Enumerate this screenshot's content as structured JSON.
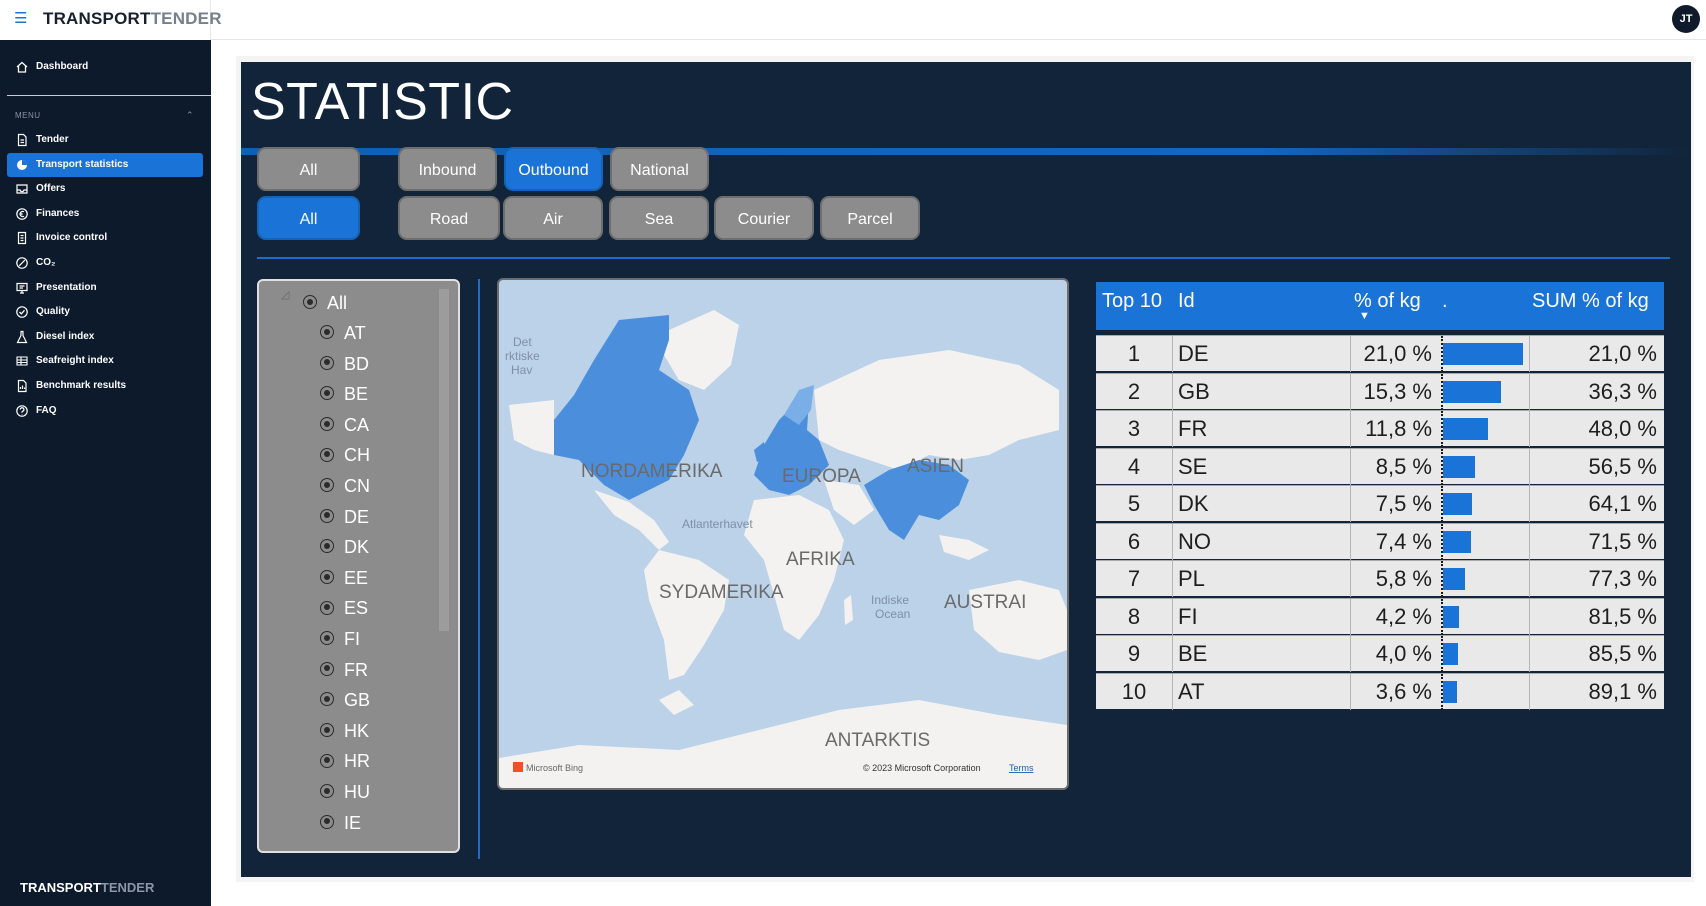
{
  "brand": {
    "part1": "TRANSPORT",
    "part2": "TENDER"
  },
  "user": {
    "initials": "JT"
  },
  "sidebar": {
    "top_item": {
      "label": "Dashboard",
      "icon": "home-icon"
    },
    "menu_label": "MENU",
    "items": [
      {
        "label": "Tender",
        "icon": "document-icon",
        "active": false
      },
      {
        "label": "Transport statistics",
        "icon": "pie-chart-icon",
        "active": true
      },
      {
        "label": "Offers",
        "icon": "inbox-icon",
        "active": false
      },
      {
        "label": "Finances",
        "icon": "euro-icon",
        "active": false
      },
      {
        "label": "Invoice control",
        "icon": "invoice-icon",
        "active": false
      },
      {
        "label": "CO₂",
        "icon": "co2-icon",
        "active": false
      },
      {
        "label": "Presentation",
        "icon": "presentation-icon",
        "active": false
      },
      {
        "label": "Quality",
        "icon": "check-circle-icon",
        "active": false
      },
      {
        "label": "Diesel index",
        "icon": "flask-icon",
        "active": false
      },
      {
        "label": "Seafreight index",
        "icon": "ship-icon",
        "active": false
      },
      {
        "label": "Benchmark results",
        "icon": "report-icon",
        "active": false
      },
      {
        "label": "FAQ",
        "icon": "help-icon",
        "active": false
      }
    ],
    "footer": {
      "part1": "TRANSPORT",
      "part2": "TENDER"
    }
  },
  "report": {
    "title": "STATISTIC",
    "direction_filters": [
      {
        "label": "All",
        "selected": false
      },
      {
        "label": "Inbound",
        "selected": false
      },
      {
        "label": "Outbound",
        "selected": true
      },
      {
        "label": "National",
        "selected": false
      }
    ],
    "mode_filters": [
      {
        "label": "All",
        "selected": true
      },
      {
        "label": "Road",
        "selected": false
      },
      {
        "label": "Air",
        "selected": false
      },
      {
        "label": "Sea",
        "selected": false
      },
      {
        "label": "Courier",
        "selected": false
      },
      {
        "label": "Parcel",
        "selected": false
      }
    ],
    "country_slicer": {
      "all_label": "All",
      "items": [
        "AT",
        "BD",
        "BE",
        "CA",
        "CH",
        "CN",
        "DE",
        "DK",
        "EE",
        "ES",
        "FI",
        "FR",
        "GB",
        "HK",
        "HR",
        "HU",
        "IE"
      ]
    },
    "map": {
      "labels": {
        "north_america": "NORDAMERIKA",
        "europe": "EUROPA",
        "asia": "ASIEN",
        "africa": "AFRIKA",
        "south_america": "SYDAMERIKA",
        "australia": "AUSTRAI",
        "antarctica": "ANTARKTIS",
        "atlantic": "Atlanterhavet",
        "indian_ocean_1": "Indiske",
        "indian_ocean_2": "Ocean",
        "arctic_1": "Det",
        "arctic_2": "rktiske",
        "arctic_3": "Hav"
      },
      "attribution": "Microsoft Bing",
      "copyright": "© 2023 Microsoft Corporation",
      "terms": "Terms",
      "colors": {
        "water": "#bcd2e8",
        "land": "#f3f2f0",
        "highlight": "#4b8fdc",
        "highlight_light": "#7aaee6"
      }
    },
    "table": {
      "headers": {
        "rank": "Top 10",
        "id": "Id",
        "pct": "% of kg",
        "bar": ".",
        "sum": "SUM % of kg"
      },
      "rows": [
        {
          "rank": "1",
          "id": "DE",
          "pct": "21,0 %",
          "value": 21.0,
          "sum": "21,0 %"
        },
        {
          "rank": "2",
          "id": "GB",
          "pct": "15,3 %",
          "value": 15.3,
          "sum": "36,3 %"
        },
        {
          "rank": "3",
          "id": "FR",
          "pct": "11,8 %",
          "value": 11.8,
          "sum": "48,0 %"
        },
        {
          "rank": "4",
          "id": "SE",
          "pct": "8,5 %",
          "value": 8.5,
          "sum": "56,5 %"
        },
        {
          "rank": "5",
          "id": "DK",
          "pct": "7,5 %",
          "value": 7.5,
          "sum": "64,1 %"
        },
        {
          "rank": "6",
          "id": "NO",
          "pct": "7,4 %",
          "value": 7.4,
          "sum": "71,5 %"
        },
        {
          "rank": "7",
          "id": "PL",
          "pct": "5,8 %",
          "value": 5.8,
          "sum": "77,3 %"
        },
        {
          "rank": "8",
          "id": "FI",
          "pct": "4,2 %",
          "value": 4.2,
          "sum": "81,5 %"
        },
        {
          "rank": "9",
          "id": "BE",
          "pct": "4,0 %",
          "value": 4.0,
          "sum": "85,5 %"
        },
        {
          "rank": "10",
          "id": "AT",
          "pct": "3,6 %",
          "value": 3.6,
          "sum": "89,1 %"
        }
      ]
    }
  }
}
